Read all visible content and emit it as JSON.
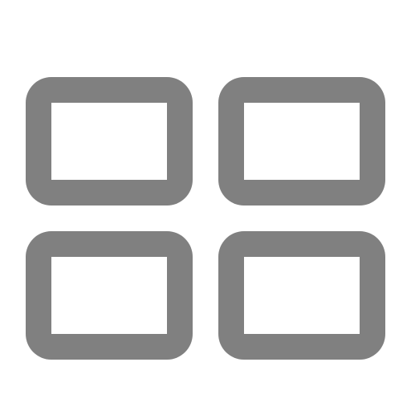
{
  "icon": {
    "name": "grid-view-icon",
    "color": "#808080",
    "background": "#ffffff",
    "tiles": [
      {
        "name": "grid-tile-top-left"
      },
      {
        "name": "grid-tile-top-right"
      },
      {
        "name": "grid-tile-bottom-left"
      },
      {
        "name": "grid-tile-bottom-right"
      }
    ]
  }
}
